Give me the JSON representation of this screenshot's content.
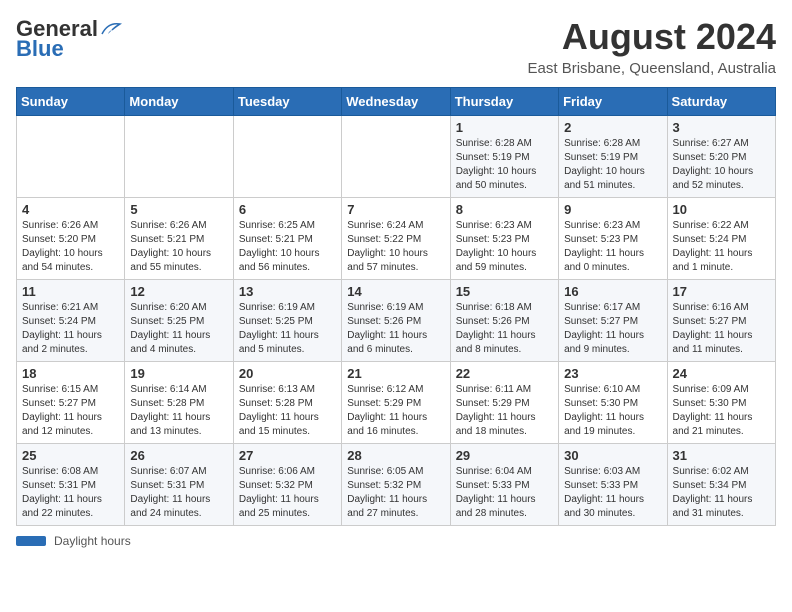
{
  "logo": {
    "text_general": "General",
    "text_blue": "Blue"
  },
  "header": {
    "month_year": "August 2024",
    "location": "East Brisbane, Queensland, Australia"
  },
  "weekdays": [
    "Sunday",
    "Monday",
    "Tuesday",
    "Wednesday",
    "Thursday",
    "Friday",
    "Saturday"
  ],
  "weeks": [
    [
      {
        "day": "",
        "info": ""
      },
      {
        "day": "",
        "info": ""
      },
      {
        "day": "",
        "info": ""
      },
      {
        "day": "",
        "info": ""
      },
      {
        "day": "1",
        "info": "Sunrise: 6:28 AM\nSunset: 5:19 PM\nDaylight: 10 hours and 50 minutes."
      },
      {
        "day": "2",
        "info": "Sunrise: 6:28 AM\nSunset: 5:19 PM\nDaylight: 10 hours and 51 minutes."
      },
      {
        "day": "3",
        "info": "Sunrise: 6:27 AM\nSunset: 5:20 PM\nDaylight: 10 hours and 52 minutes."
      }
    ],
    [
      {
        "day": "4",
        "info": "Sunrise: 6:26 AM\nSunset: 5:20 PM\nDaylight: 10 hours and 54 minutes."
      },
      {
        "day": "5",
        "info": "Sunrise: 6:26 AM\nSunset: 5:21 PM\nDaylight: 10 hours and 55 minutes."
      },
      {
        "day": "6",
        "info": "Sunrise: 6:25 AM\nSunset: 5:21 PM\nDaylight: 10 hours and 56 minutes."
      },
      {
        "day": "7",
        "info": "Sunrise: 6:24 AM\nSunset: 5:22 PM\nDaylight: 10 hours and 57 minutes."
      },
      {
        "day": "8",
        "info": "Sunrise: 6:23 AM\nSunset: 5:23 PM\nDaylight: 10 hours and 59 minutes."
      },
      {
        "day": "9",
        "info": "Sunrise: 6:23 AM\nSunset: 5:23 PM\nDaylight: 11 hours and 0 minutes."
      },
      {
        "day": "10",
        "info": "Sunrise: 6:22 AM\nSunset: 5:24 PM\nDaylight: 11 hours and 1 minute."
      }
    ],
    [
      {
        "day": "11",
        "info": "Sunrise: 6:21 AM\nSunset: 5:24 PM\nDaylight: 11 hours and 2 minutes."
      },
      {
        "day": "12",
        "info": "Sunrise: 6:20 AM\nSunset: 5:25 PM\nDaylight: 11 hours and 4 minutes."
      },
      {
        "day": "13",
        "info": "Sunrise: 6:19 AM\nSunset: 5:25 PM\nDaylight: 11 hours and 5 minutes."
      },
      {
        "day": "14",
        "info": "Sunrise: 6:19 AM\nSunset: 5:26 PM\nDaylight: 11 hours and 6 minutes."
      },
      {
        "day": "15",
        "info": "Sunrise: 6:18 AM\nSunset: 5:26 PM\nDaylight: 11 hours and 8 minutes."
      },
      {
        "day": "16",
        "info": "Sunrise: 6:17 AM\nSunset: 5:27 PM\nDaylight: 11 hours and 9 minutes."
      },
      {
        "day": "17",
        "info": "Sunrise: 6:16 AM\nSunset: 5:27 PM\nDaylight: 11 hours and 11 minutes."
      }
    ],
    [
      {
        "day": "18",
        "info": "Sunrise: 6:15 AM\nSunset: 5:27 PM\nDaylight: 11 hours and 12 minutes."
      },
      {
        "day": "19",
        "info": "Sunrise: 6:14 AM\nSunset: 5:28 PM\nDaylight: 11 hours and 13 minutes."
      },
      {
        "day": "20",
        "info": "Sunrise: 6:13 AM\nSunset: 5:28 PM\nDaylight: 11 hours and 15 minutes."
      },
      {
        "day": "21",
        "info": "Sunrise: 6:12 AM\nSunset: 5:29 PM\nDaylight: 11 hours and 16 minutes."
      },
      {
        "day": "22",
        "info": "Sunrise: 6:11 AM\nSunset: 5:29 PM\nDaylight: 11 hours and 18 minutes."
      },
      {
        "day": "23",
        "info": "Sunrise: 6:10 AM\nSunset: 5:30 PM\nDaylight: 11 hours and 19 minutes."
      },
      {
        "day": "24",
        "info": "Sunrise: 6:09 AM\nSunset: 5:30 PM\nDaylight: 11 hours and 21 minutes."
      }
    ],
    [
      {
        "day": "25",
        "info": "Sunrise: 6:08 AM\nSunset: 5:31 PM\nDaylight: 11 hours and 22 minutes."
      },
      {
        "day": "26",
        "info": "Sunrise: 6:07 AM\nSunset: 5:31 PM\nDaylight: 11 hours and 24 minutes."
      },
      {
        "day": "27",
        "info": "Sunrise: 6:06 AM\nSunset: 5:32 PM\nDaylight: 11 hours and 25 minutes."
      },
      {
        "day": "28",
        "info": "Sunrise: 6:05 AM\nSunset: 5:32 PM\nDaylight: 11 hours and 27 minutes."
      },
      {
        "day": "29",
        "info": "Sunrise: 6:04 AM\nSunset: 5:33 PM\nDaylight: 11 hours and 28 minutes."
      },
      {
        "day": "30",
        "info": "Sunrise: 6:03 AM\nSunset: 5:33 PM\nDaylight: 11 hours and 30 minutes."
      },
      {
        "day": "31",
        "info": "Sunrise: 6:02 AM\nSunset: 5:34 PM\nDaylight: 11 hours and 31 minutes."
      }
    ]
  ],
  "footer": {
    "daylight_label": "Daylight hours"
  }
}
